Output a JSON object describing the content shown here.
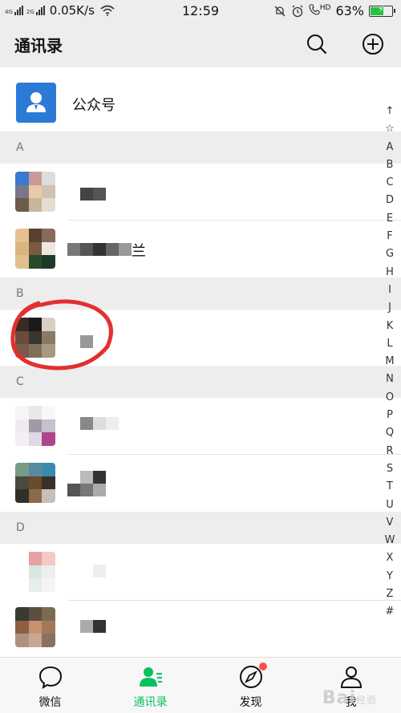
{
  "status_bar": {
    "network_1": "4G",
    "network_2": "2G",
    "speed": "0.05K/s",
    "time": "12:59",
    "hd": "HD",
    "battery": "63%",
    "battery_level": 0.63
  },
  "header": {
    "title": "通讯录",
    "search_icon": "search-icon",
    "add_icon": "plus-circle-icon"
  },
  "official_accounts": {
    "label": "公众号",
    "icon": "person-icon"
  },
  "sections": [
    {
      "letter": "A"
    },
    {
      "letter": "B"
    },
    {
      "letter": "C"
    },
    {
      "letter": "D"
    }
  ],
  "contacts": {
    "a1_name": "",
    "a2_name": "兰"
  },
  "index_bar": [
    "↑",
    "☆",
    "A",
    "B",
    "C",
    "D",
    "E",
    "F",
    "G",
    "H",
    "I",
    "J",
    "K",
    "L",
    "M",
    "N",
    "O",
    "P",
    "Q",
    "R",
    "S",
    "T",
    "U",
    "V",
    "W",
    "X",
    "Y",
    "Z",
    "#"
  ],
  "tabs": [
    {
      "label": "微信",
      "icon": "chat-bubble-icon"
    },
    {
      "label": "通讯录",
      "icon": "contacts-icon"
    },
    {
      "label": "发现",
      "icon": "compass-icon"
    },
    {
      "label": "我",
      "icon": "person-icon"
    }
  ],
  "colors": {
    "accent": "#07c160",
    "badge": "#fa5151",
    "official_blue": "#2b7bd6",
    "annotation": "#e23030"
  },
  "watermark": {
    "text": "Bai",
    "suffix": "经验"
  }
}
